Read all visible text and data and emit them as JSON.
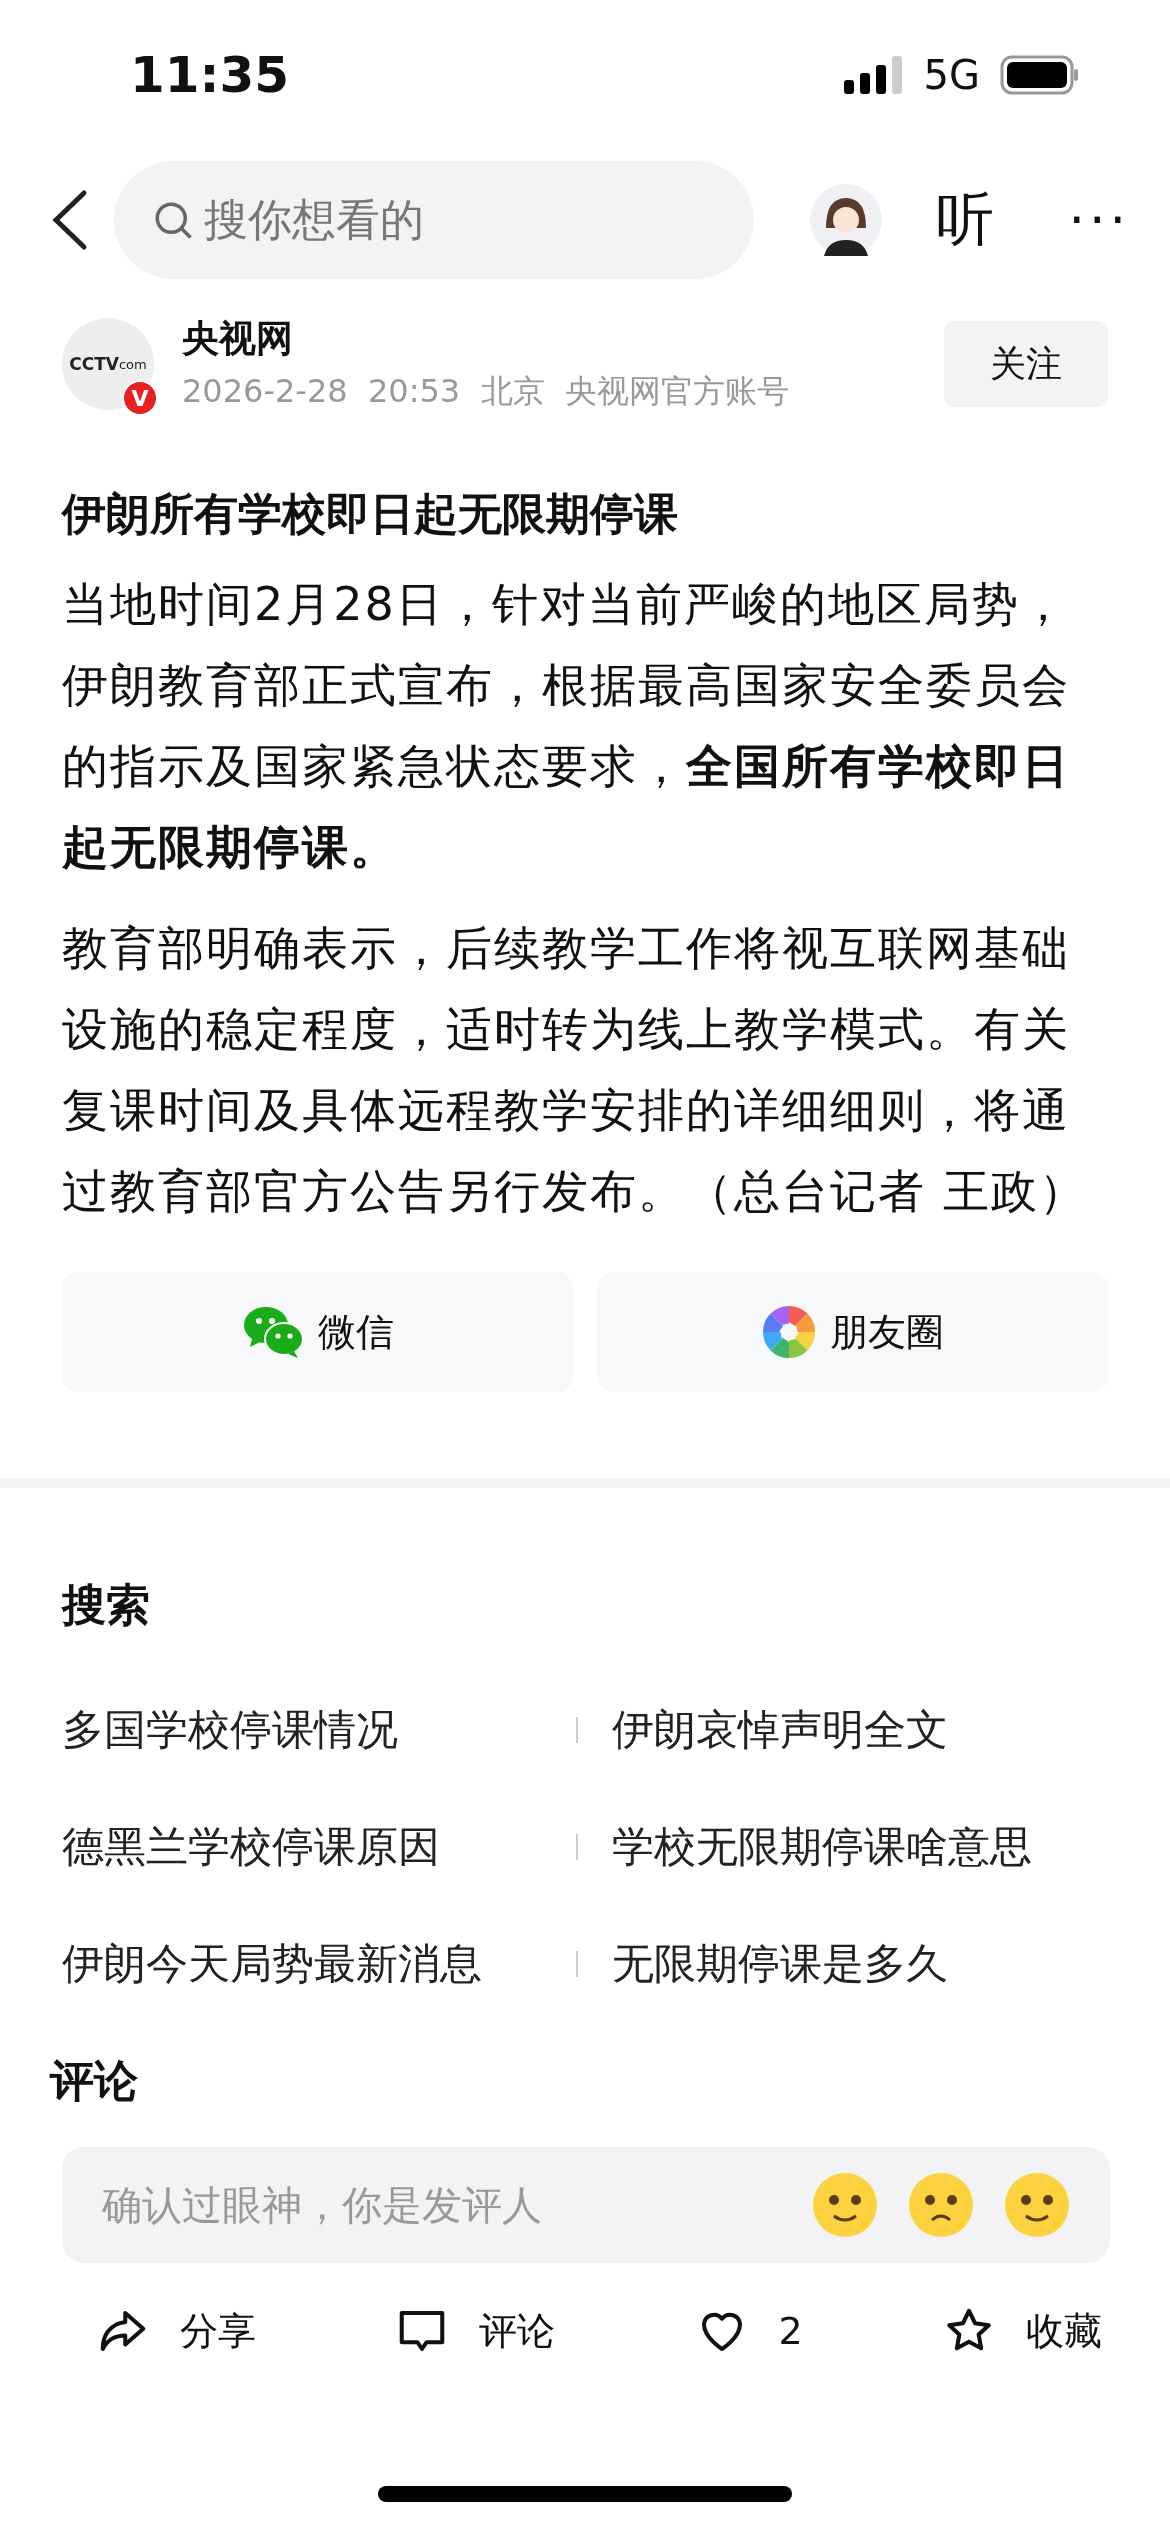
{
  "status_bar": {
    "time": "11:35",
    "network": "5G"
  },
  "nav": {
    "search": {
      "placeholder": "搜你想看的"
    },
    "listen": "听",
    "more": "···"
  },
  "author": {
    "logo": [
      "CCTV",
      "com"
    ],
    "badge": "V",
    "name": "央视网",
    "meta": "2026-2-28  20:53  北京  央视网官方账号",
    "follow": "关注"
  },
  "article": {
    "title": "伊朗所有学校即日起无限期停课",
    "paragraphs": [
      "当地时间2月28日，针对当前严峻的地区局势，伊朗教育部正式宣布，根据最高国家安全委员会的指示及国家紧急状态要求，**全国所有学校即日起无限期停课。**",
      "教育部明确表示，后续教学工作将视互联网基础设施的稳定程度，适时转为线上教学模式。有关复课时间及具体远程教学安排的详细细则，将通过教育部官方公告另行发布。（总台记者 王政）"
    ]
  },
  "share": [
    {
      "kind": "wechat",
      "label": "微信"
    },
    {
      "kind": "moments",
      "label": "朋友圈"
    }
  ],
  "search_section": {
    "title": "搜索",
    "items": [
      "多国学校停课情况",
      "伊朗哀悼声明全文",
      "德黑兰学校停课原因",
      "学校无限期停课啥意思",
      "伊朗今天局势最新消息",
      "无限期停课是多久"
    ]
  },
  "comments": {
    "title": "评论",
    "placeholder": "确认过眼神，你是发评人"
  },
  "bottom_bar": [
    {
      "kind": "share",
      "label": "分享"
    },
    {
      "kind": "comment",
      "label": "评论"
    },
    {
      "kind": "like",
      "label": "2"
    },
    {
      "kind": "favorite",
      "label": "收藏"
    }
  ]
}
